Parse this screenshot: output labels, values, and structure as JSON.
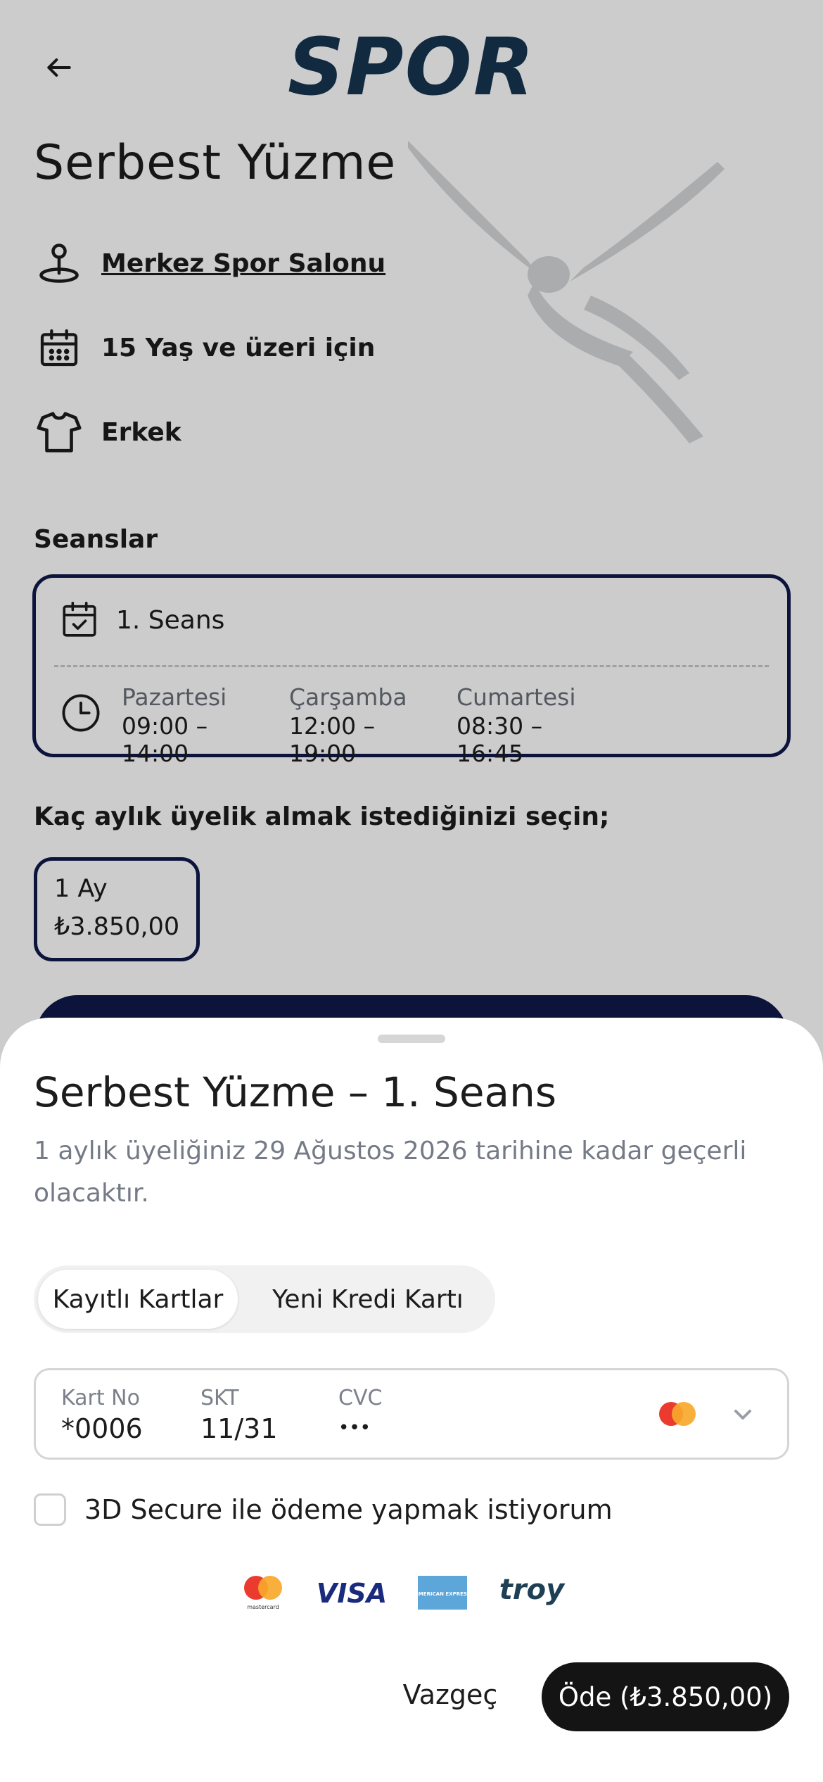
{
  "header": {
    "back_icon": "arrow-left-icon",
    "logo_text": "SPOR",
    "brand_color": "#163550"
  },
  "course": {
    "title": "Serbest Yüzme",
    "location": "Merkez Spor Salonu",
    "age": "15 Yaş ve üzeri için",
    "gender": "Erkek"
  },
  "sessions": {
    "label": "Seanslar",
    "items": [
      {
        "name": "1. Seans",
        "schedule": [
          {
            "day": "Pazartesi",
            "hours": "09:00 – 14:00"
          },
          {
            "day": "Çarşamba",
            "hours": "12:00 – 19:00"
          },
          {
            "day": "Cumartesi",
            "hours": "08:30 – 16:45"
          }
        ]
      }
    ]
  },
  "membership": {
    "label": "Kaç aylık üyelik almak istediğinizi seçin;",
    "plans": [
      {
        "name": "1 Ay",
        "price": "₺3.850,00",
        "selected": true
      }
    ]
  },
  "sheet": {
    "title": "Serbest Yüzme – 1. Seans",
    "description": "1 aylık üyeliğiniz 29 Ağustos 2026 tarihine kadar geçerli olacaktır.",
    "tabs": [
      {
        "label": "Kayıtlı Kartlar",
        "active": true
      },
      {
        "label": "Yeni Kredi Kartı",
        "active": false
      }
    ],
    "card": {
      "no_label": "Kart No",
      "no_value": "*0006",
      "exp_label": "SKT",
      "exp_value": "11/31",
      "cvc_label": "CVC",
      "cvc_value": "•••",
      "brand": "mastercard"
    },
    "secure_label": "3D Secure ile ödeme yapmak istiyorum",
    "secure_checked": false,
    "payment_logos": [
      "mastercard",
      "VISA",
      "AMERICAN EXPRESS",
      "troy"
    ],
    "cancel_label": "Vazgeç",
    "pay_label": "Öde (₺3.850,00)"
  },
  "colors": {
    "accent_navy": "#0f1a4a",
    "pay_button": "#141414",
    "muted_text": "#747a86"
  }
}
